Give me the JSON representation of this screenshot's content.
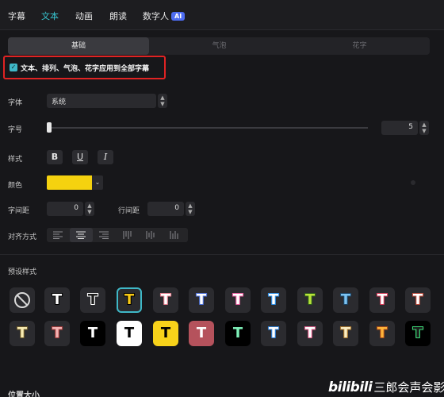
{
  "top_tabs": [
    {
      "label": "字幕",
      "active": false
    },
    {
      "label": "文本",
      "active": true
    },
    {
      "label": "动画",
      "active": false
    },
    {
      "label": "朗读",
      "active": false
    },
    {
      "label": "数字人",
      "active": false,
      "badge": "AI"
    }
  ],
  "sub_tabs": [
    {
      "label": "基础",
      "active": true
    },
    {
      "label": "气泡",
      "active": false
    },
    {
      "label": "花字",
      "active": false
    }
  ],
  "apply_all": {
    "checked": true,
    "label": "文本、排列、气泡、花字应用到全部字幕"
  },
  "font": {
    "label": "字体",
    "value": "系统"
  },
  "font_size": {
    "label": "字号",
    "value": "5"
  },
  "style": {
    "label": "样式",
    "bold": "B",
    "underline": "U",
    "italic": "I"
  },
  "color": {
    "label": "颜色",
    "value": "#f5d20f"
  },
  "letter_spacing": {
    "label": "字间距",
    "value": "0"
  },
  "line_spacing": {
    "label": "行间距",
    "value": "0"
  },
  "alignment": {
    "label": "对齐方式",
    "options": [
      "align-left",
      "align-center",
      "align-right",
      "vertical-top",
      "vertical-middle",
      "vertical-bottom"
    ]
  },
  "presets": {
    "label": "预设样式",
    "glyph": "T",
    "items": [
      {
        "icon": "none",
        "fill": "#2b2b2f",
        "text": "#ffffff",
        "stroke": ""
      },
      {
        "icon": "T",
        "fill": "#2b2b2f",
        "text": "#ffffff",
        "stroke": "#000000"
      },
      {
        "icon": "T",
        "fill": "#2b2b2f",
        "text": "#1c1c1c",
        "stroke": "#ffffff"
      },
      {
        "icon": "T",
        "fill": "#2b2b2f",
        "text": "#f7c815",
        "stroke": "#000000",
        "selected": true
      },
      {
        "icon": "T",
        "fill": "#2b2b2f",
        "text": "#ffffff",
        "stroke": "#e07b8b"
      },
      {
        "icon": "T",
        "fill": "#2b2b2f",
        "text": "#ffffff",
        "stroke": "#4b6fd6"
      },
      {
        "icon": "T",
        "fill": "#2b2b2f",
        "text": "#ffffff",
        "stroke": "#e55b9c"
      },
      {
        "icon": "T",
        "fill": "#2b2b2f",
        "text": "#ffffff",
        "stroke": "#2e8fe6"
      },
      {
        "icon": "T",
        "fill": "#2b2b2f",
        "text": "#b8e33a",
        "stroke": "#2d5a1a"
      },
      {
        "icon": "T",
        "fill": "#2b2b2f",
        "text": "#7cc3f2",
        "stroke": "#1b4466"
      },
      {
        "icon": "T",
        "fill": "#2b2b2f",
        "text": "#ffffff",
        "stroke": "#d23a56"
      },
      {
        "icon": "T",
        "fill": "#2b2b2f",
        "text": "#ffffff",
        "stroke": "#b8483a"
      },
      {
        "icon": "T",
        "fill": "#2b2b2f",
        "text": "#f8ecb2",
        "stroke": "#6d5a2a"
      },
      {
        "icon": "T",
        "fill": "#2b2b2f",
        "text": "#f4b4b4",
        "stroke": "#a33a3a"
      },
      {
        "icon": "T",
        "fill": "#000000",
        "text": "#ffffff",
        "stroke": ""
      },
      {
        "icon": "T",
        "fill": "#ffffff",
        "text": "#000000",
        "stroke": ""
      },
      {
        "icon": "T",
        "fill": "#f7d21a",
        "text": "#000000",
        "stroke": ""
      },
      {
        "icon": "T",
        "fill": "#b5525c",
        "text": "#ffffff",
        "stroke": ""
      },
      {
        "icon": "T",
        "fill": "#000000",
        "text": "#7ef0b8",
        "stroke": ""
      },
      {
        "icon": "T",
        "fill": "#2b2b2f",
        "text": "#ffffff",
        "stroke": "#2d7fd6"
      },
      {
        "icon": "T",
        "fill": "#2b2b2f",
        "text": "#ffffff",
        "stroke": "#e05b8a"
      },
      {
        "icon": "T",
        "fill": "#2b2b2f",
        "text": "#fbeec4",
        "stroke": "#a8762e"
      },
      {
        "icon": "T",
        "fill": "#2b2b2f",
        "text": "#ffb43a",
        "stroke": "#a64a1a"
      },
      {
        "icon": "T",
        "fill": "#000000",
        "text": "#1c1c1c",
        "stroke": "#3ee07a"
      }
    ]
  },
  "bottom_section": {
    "label": "位置大小"
  },
  "watermark": {
    "logo": "bilibili",
    "text": "三郎会声会影"
  }
}
